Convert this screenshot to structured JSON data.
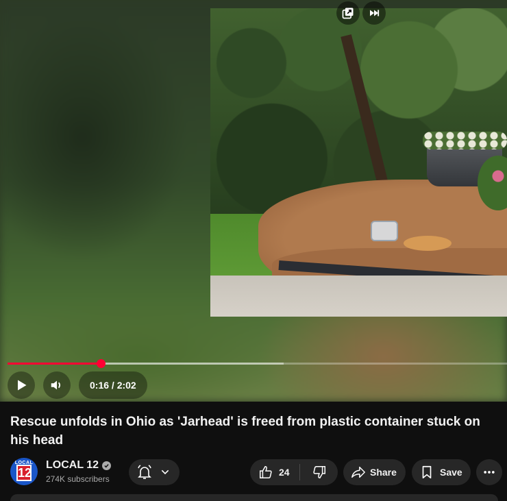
{
  "video": {
    "current_time": "0:16",
    "duration": "2:02",
    "time_display": "0:16 / 2:02",
    "played_fraction": 0.187,
    "buffered_fraction": 0.553
  },
  "player_icons": {
    "miniplayer": "miniplayer-icon",
    "next": "skip-next-icon",
    "play": "play-icon",
    "volume": "volume-icon"
  },
  "title": "Rescue unfolds in Ohio as 'Jarhead' is freed from plastic container stuck on his head",
  "channel": {
    "name": "LOCAL 12",
    "subscribers": "274K subscribers",
    "logo_top": "LOCAL",
    "logo_number": "12"
  },
  "actions": {
    "like_count": "24",
    "share_label": "Share",
    "save_label": "Save"
  },
  "colors": {
    "accent": "#ff0033",
    "background": "#0f0f0f",
    "pill": "#272727"
  }
}
